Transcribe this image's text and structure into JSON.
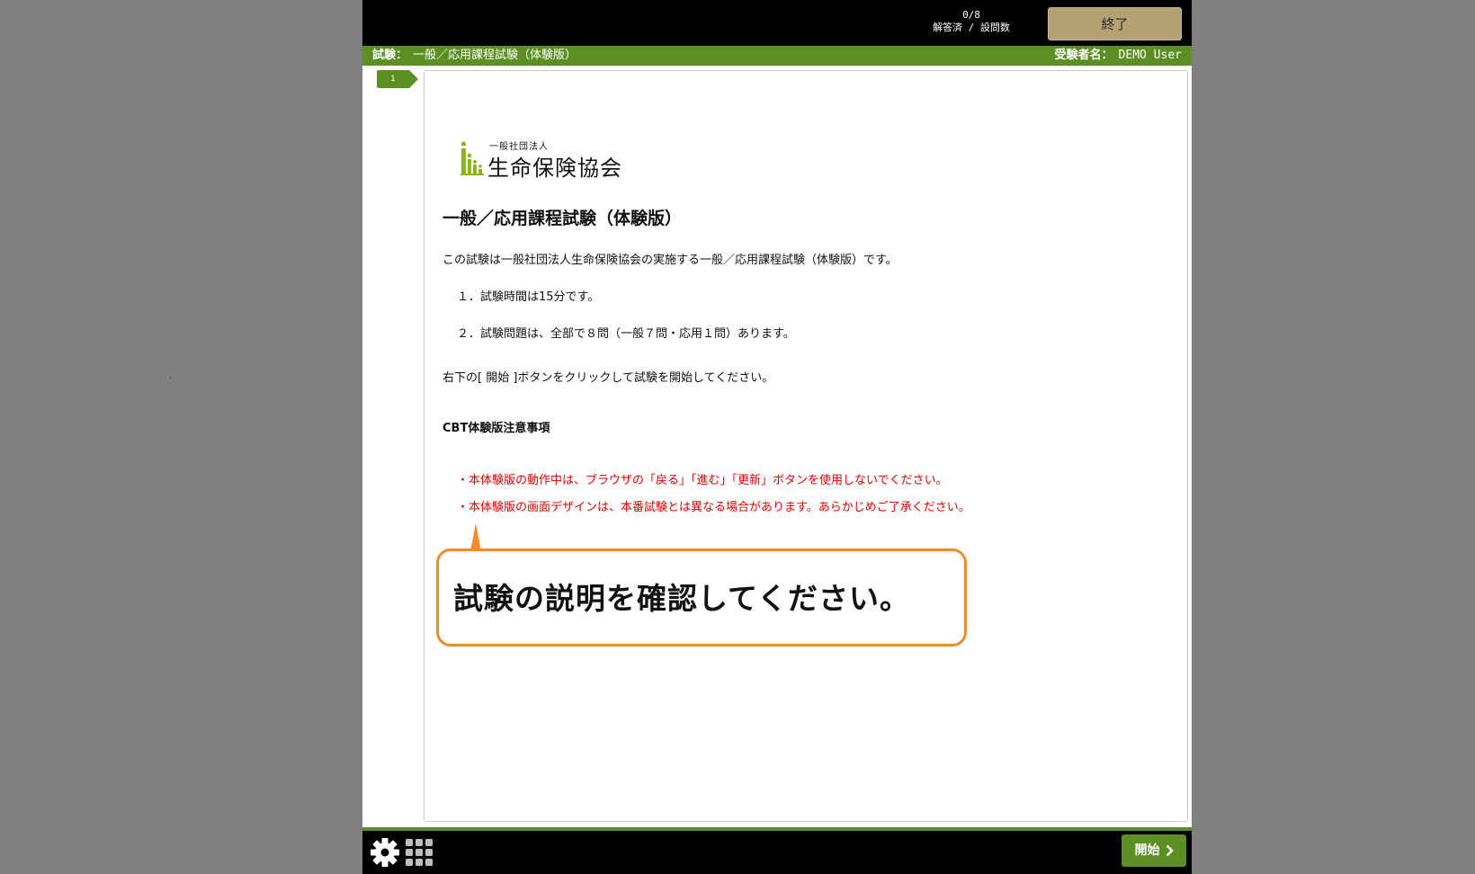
{
  "header": {
    "progress_count": "0/8",
    "progress_label": "解答済 / 設問数",
    "end_button_label": "終了"
  },
  "infobar": {
    "exam_label": "試験：",
    "exam_name": "一般／応用課程試験（体験版）",
    "candidate_label": "受験者名：",
    "candidate_name": "DEMO User"
  },
  "question_tab": {
    "number": "1"
  },
  "content": {
    "logo_small": "一般社団法人",
    "logo_main": "生命保険協会",
    "heading": "一般／応用課程試験（体験版）",
    "intro": "この試験は一般社団法人生命保険協会の実施する一般／応用課程試験（体験版）です。",
    "item1": "１．試験時間は15分です。",
    "item2": "２．試験問題は、全部で８問（一般７問・応用１問）あります。",
    "instruction": "右下の[ 開始 ]ボタンをクリックして試験を開始してください。",
    "notes_heading": "CBT体験版注意事項",
    "warnings": [
      "・本体験版の動作中は、ブラウザの「戻る」「進む」「更新」ボタンを使用しないでください。",
      "・本体験版の画面デザインは、本番試験とは異なる場合があります。あらかじめご了承ください。"
    ],
    "callout": "試験の説明を確認してください。"
  },
  "footer": {
    "start_button_label": "開始",
    "settings_icon": "gear-icon",
    "grid_icon": "grid-icon"
  },
  "colors": {
    "accent_green": "#5b8e23",
    "end_button": "#b5a273",
    "warning_red": "#e60000",
    "callout_border": "#ef8a2e",
    "frame_gray": "#808080"
  }
}
